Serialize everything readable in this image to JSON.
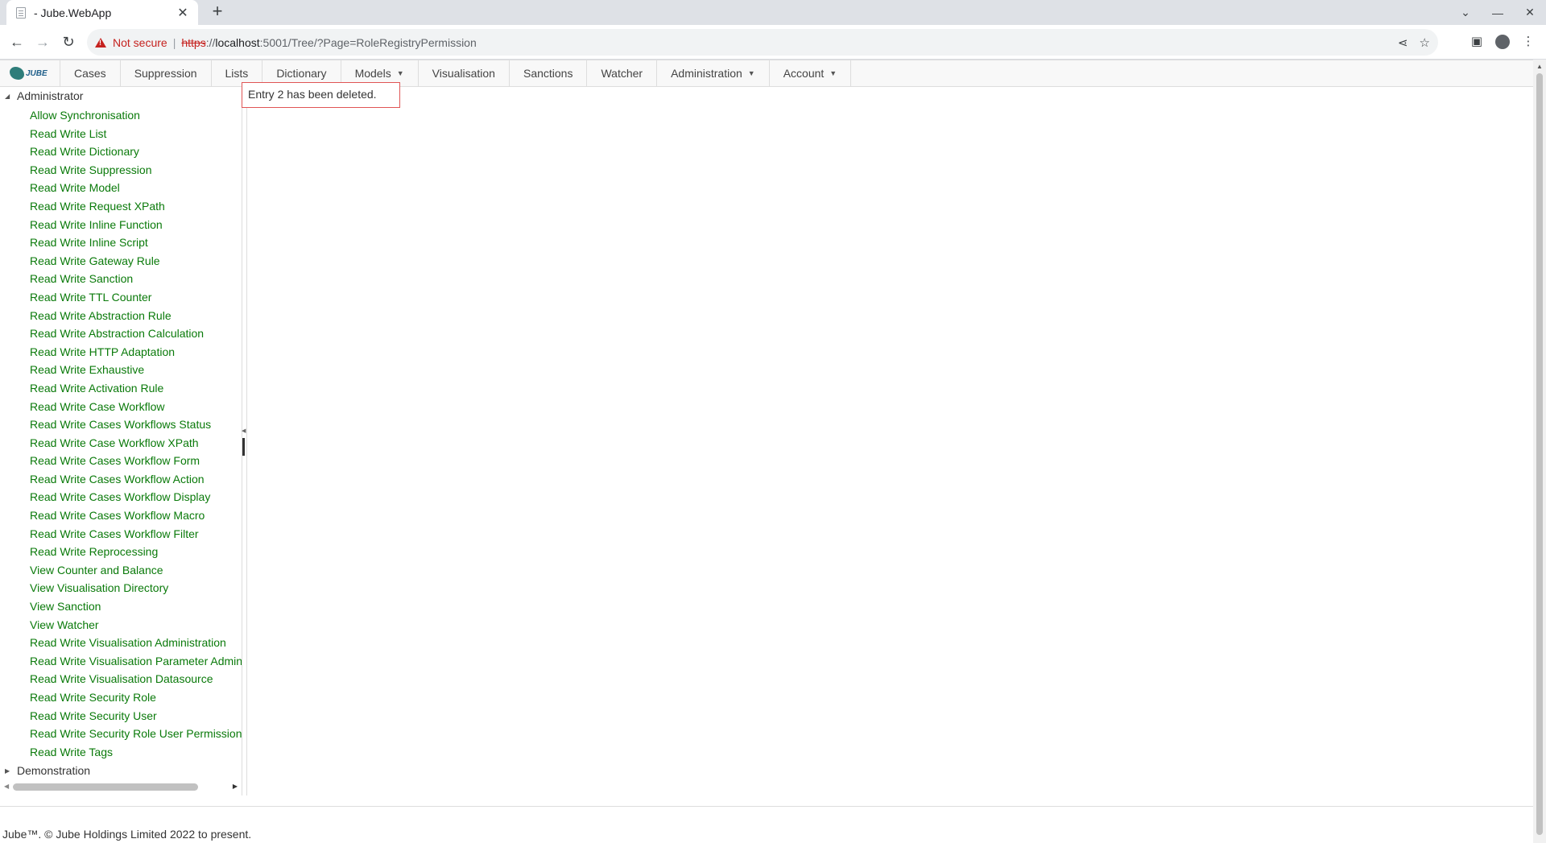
{
  "browser": {
    "tab_title": "- Jube.WebApp",
    "security_label": "Not secure",
    "url_protocol": "https",
    "url_sep": "://",
    "url_host": "localhost",
    "url_rest": ":5001/Tree/?Page=RoleRegistryPermission"
  },
  "menu": {
    "logo_text": "JUBE",
    "items": [
      {
        "label": "Cases"
      },
      {
        "label": "Suppression"
      },
      {
        "label": "Lists"
      },
      {
        "label": "Dictionary"
      },
      {
        "label": "Models",
        "has_dropdown": true
      },
      {
        "label": "Visualisation"
      },
      {
        "label": "Sanctions"
      },
      {
        "label": "Watcher"
      },
      {
        "label": "Administration",
        "has_dropdown": true
      },
      {
        "label": "Account",
        "has_dropdown": true
      }
    ]
  },
  "tree": {
    "root_label": "Administrator",
    "items": [
      "Allow Synchronisation",
      "Read Write List",
      "Read Write Dictionary",
      "Read Write Suppression",
      "Read Write Model",
      "Read Write Request XPath",
      "Read Write Inline Function",
      "Read Write Inline Script",
      "Read Write Gateway Rule",
      "Read Write Sanction",
      "Read Write TTL Counter",
      "Read Write Abstraction Rule",
      "Read Write Abstraction Calculation",
      "Read Write HTTP Adaptation",
      "Read Write Exhaustive",
      "Read Write Activation Rule",
      "Read Write Case Workflow",
      "Read Write Cases Workflows Status",
      "Read Write Case Workflow XPath",
      "Read Write Cases Workflow Form",
      "Read Write Cases Workflow Action",
      "Read Write Cases Workflow Display",
      "Read Write Cases Workflow Macro",
      "Read Write Cases Workflow Filter",
      "Read Write Reprocessing",
      "View Counter and Balance",
      "View Visualisation Directory",
      "View Sanction",
      "View Watcher",
      "Read Write Visualisation Administration",
      "Read Write Visualisation Parameter Admin",
      "Read Write Visualisation Datasource",
      "Read Write Security Role",
      "Read Write Security User",
      "Read Write Security Role User Permission",
      "Read Write Tags"
    ],
    "second_root_label": "Demonstration"
  },
  "alert": {
    "message": "Entry 2 has been deleted."
  },
  "footer": {
    "text": "Jube™. © Jube Holdings Limited 2022 to present."
  }
}
